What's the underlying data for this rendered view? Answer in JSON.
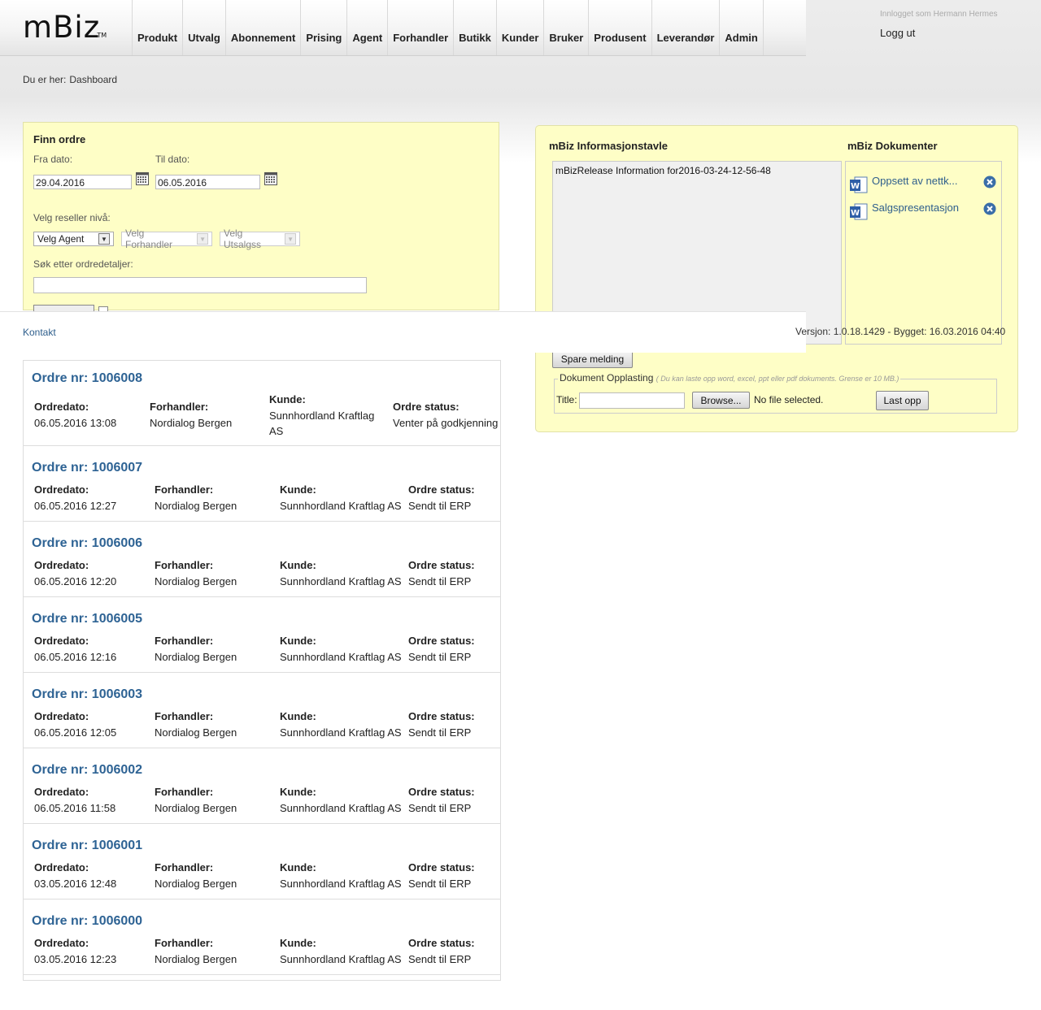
{
  "app": {
    "logo": "mBiz",
    "logo_tm": "TM"
  },
  "nav": [
    "Produkt",
    "Utvalg",
    "Abonnement",
    "Prising",
    "Agent",
    "Forhandler",
    "Butikk",
    "Kunder",
    "Bruker",
    "Produsent",
    "Leverandør",
    "Admin"
  ],
  "user": {
    "logged_in_as": "Innlogget som Hermann Hermes",
    "logout": "Logg ut"
  },
  "breadcrumb": {
    "prefix": "Du er her:",
    "current": "Dashboard"
  },
  "find_order": {
    "title": "Finn ordre",
    "from_label": "Fra dato:",
    "from_value": "29.04.2016",
    "to_label": "Til dato:",
    "to_value": "06.05.2016",
    "reseller_label": "Velg reseller nivå:",
    "agent_select": "Velg Agent",
    "forhandler_select": "Velg Forhandler",
    "utsalgssted_select": "Velg Utsalgss",
    "search_label": "Søk etter ordredetaljer:",
    "search_value": ""
  },
  "footer": {
    "contact": "Kontakt",
    "version": "Versjon: 1.0.18.1429 - Bygget: 16.03.2016 04:40"
  },
  "info_board": {
    "title": "mBiz Informasjonstavle",
    "message": "mBizRelease Information for2016-03-24-12-56-48",
    "save_button": "Spare melding"
  },
  "documents": {
    "title": "mBiz Dokumenter",
    "items": [
      {
        "name": "Oppsett av nettk...",
        "icon": "word-doc-icon"
      },
      {
        "name": "Salgspresentasjon",
        "icon": "word-doc-icon"
      }
    ]
  },
  "upload": {
    "legend": "Dokument Opplasting",
    "hint": "( Du kan laste opp word, excel, ppt eller pdf dokuments. Grense er 10 MB.)",
    "title_label": "Title:",
    "title_value": "",
    "browse_button": "Browse...",
    "file_status": "No file selected.",
    "upload_button": "Last opp"
  },
  "order_headers": {
    "date": "Ordredato:",
    "dealer": "Forhandler:",
    "customer": "Kunde:",
    "status": "Ordre status:"
  },
  "orders": [
    {
      "title": "Ordre nr: 1006008",
      "date": "06.05.2016 13:08",
      "dealer": "Nordialog Bergen",
      "customer": "Sunnhordland Kraftlag AS",
      "status": "Venter på godkjenning"
    },
    {
      "title": "Ordre nr: 1006007",
      "date": "06.05.2016 12:27",
      "dealer": "Nordialog Bergen",
      "customer": "Sunnhordland Kraftlag AS",
      "status": "Sendt til ERP"
    },
    {
      "title": "Ordre nr: 1006006",
      "date": "06.05.2016 12:20",
      "dealer": "Nordialog Bergen",
      "customer": "Sunnhordland Kraftlag AS",
      "status": "Sendt til ERP"
    },
    {
      "title": "Ordre nr: 1006005",
      "date": "06.05.2016 12:16",
      "dealer": "Nordialog Bergen",
      "customer": "Sunnhordland Kraftlag AS",
      "status": "Sendt til ERP"
    },
    {
      "title": "Ordre nr: 1006003",
      "date": "06.05.2016 12:05",
      "dealer": "Nordialog Bergen",
      "customer": "Sunnhordland Kraftlag AS",
      "status": "Sendt til ERP"
    },
    {
      "title": "Ordre nr: 1006002",
      "date": "06.05.2016 11:58",
      "dealer": "Nordialog Bergen",
      "customer": "Sunnhordland Kraftlag AS",
      "status": "Sendt til ERP"
    },
    {
      "title": "Ordre nr: 1006001",
      "date": "03.05.2016 12:48",
      "dealer": "Nordialog Bergen",
      "customer": "Sunnhordland Kraftlag AS",
      "status": "Sendt til ERP"
    },
    {
      "title": "Ordre nr: 1006000",
      "date": "03.05.2016 12:23",
      "dealer": "Nordialog Bergen",
      "customer": "Sunnhordland Kraftlag AS",
      "status": "Sendt til ERP"
    }
  ]
}
